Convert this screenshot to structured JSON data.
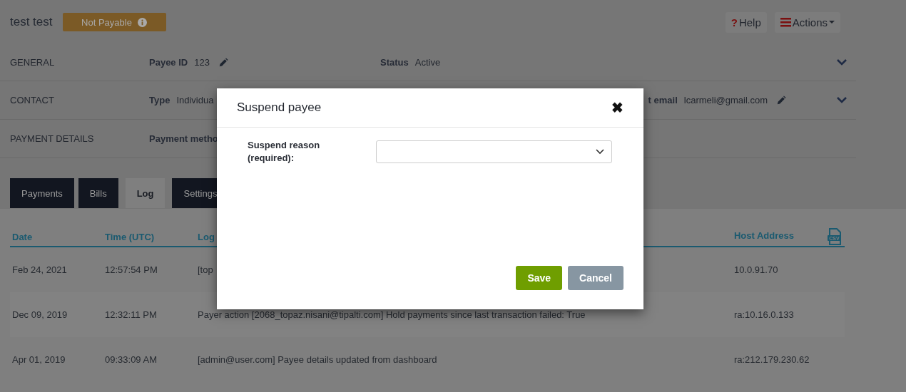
{
  "header": {
    "name": "test test",
    "badge": "Not Payable",
    "help_icon": "?",
    "help": "Help",
    "actions": "Actions"
  },
  "sections": [
    {
      "title": "GENERAL",
      "fields": [
        {
          "label": "Payee ID",
          "value": "123",
          "editable": true
        },
        {
          "label": "Status",
          "value": "Active",
          "editable": false
        }
      ]
    },
    {
      "title": "CONTACT",
      "fields": [
        {
          "label": "Type",
          "value": "Individua",
          "editable": false
        },
        {
          "label": "t email",
          "value": "lcarmeli@gmail.com",
          "editable": true
        }
      ]
    },
    {
      "title": "PAYMENT DETAILS",
      "fields": [
        {
          "label": "Payment metho",
          "editable": false
        }
      ]
    }
  ],
  "tabs": [
    {
      "label": "Payments",
      "selected": false
    },
    {
      "label": "Bills",
      "selected": false
    },
    {
      "label": "Log",
      "selected": true
    },
    {
      "label": "Settings",
      "selected": false
    }
  ],
  "table": {
    "columns": [
      "Date",
      "Time (UTC)",
      "Log",
      "Host Address"
    ],
    "csv_icon_label": "CSV",
    "rows": [
      [
        "Feb 24, 2021",
        "12:57:54 PM",
        "[top",
        "10.0.91.70"
      ],
      [
        "Dec 09, 2019",
        "12:32:11 PM",
        "Payer action [2068_topaz.nisani@tipalti.com] Hold payments since last transaction failed: True",
        "ra:10.16.0.133"
      ],
      [
        "Apr 01, 2019",
        "09:33:09 AM",
        "[admin@user.com] Payee details updated from dashboard",
        "ra:212.179.230.62"
      ]
    ]
  },
  "modal": {
    "title": "Suspend payee",
    "close": "✖",
    "field_label": "Suspend reason (required):",
    "buttons": [
      "Save",
      "Cancel"
    ]
  }
}
